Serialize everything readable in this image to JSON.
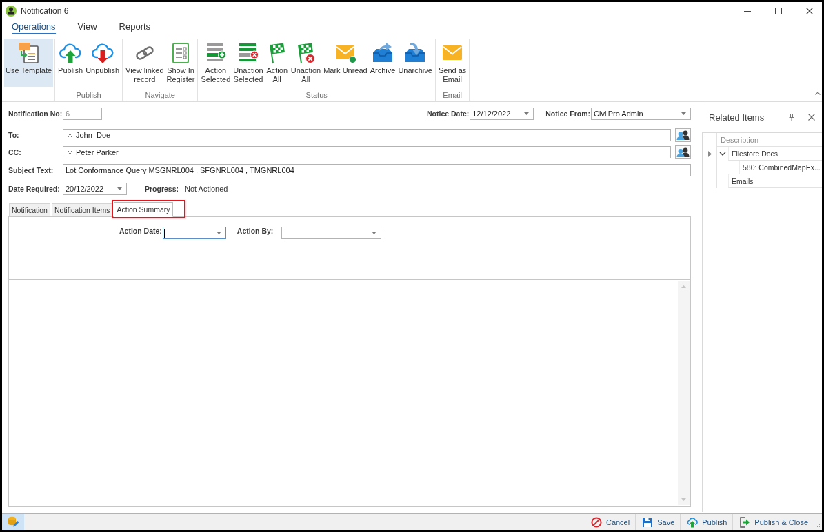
{
  "window": {
    "title": "Notification 6"
  },
  "ribbon": {
    "tabs": [
      {
        "label": "Operations",
        "selected": true
      },
      {
        "label": "View",
        "selected": false
      },
      {
        "label": "Reports",
        "selected": false
      }
    ],
    "groups": [
      {
        "buttons": [
          {
            "kind": "use_template",
            "label": "Use Template",
            "selected": true
          }
        ]
      },
      {
        "label": "Publish",
        "buttons": [
          {
            "kind": "publish",
            "label": "Publish",
            "selected": false
          },
          {
            "kind": "unpublish",
            "label": "Unpublish",
            "selected": false
          }
        ]
      },
      {
        "label": "Navigate",
        "buttons": [
          {
            "kind": "view_linked",
            "label": "View linked\nrecord",
            "selected": false
          },
          {
            "kind": "show_register",
            "label": "Show In\nRegister",
            "selected": false
          }
        ]
      },
      {
        "label": "Status",
        "buttons": [
          {
            "kind": "action_selected",
            "label": "Action\nSelected",
            "selected": false
          },
          {
            "kind": "unaction_selected",
            "label": "Unaction\nSelected",
            "selected": false
          },
          {
            "kind": "action_all",
            "label": "Action\nAll",
            "selected": false
          },
          {
            "kind": "unaction_all",
            "label": "Unaction\nAll",
            "selected": false
          },
          {
            "kind": "mark_unread",
            "label": "Mark Unread",
            "selected": false
          },
          {
            "kind": "archive",
            "label": "Archive",
            "selected": false
          },
          {
            "kind": "unarchive",
            "label": "Unarchive",
            "selected": false
          }
        ]
      },
      {
        "label": "Email",
        "buttons": [
          {
            "kind": "send_email",
            "label": "Send as\nEmail",
            "selected": false
          }
        ]
      }
    ]
  },
  "form": {
    "notification_no": {
      "label": "Notification No:",
      "value": "6",
      "disabled": true
    },
    "notice_date": {
      "label": "Notice Date:",
      "value": "12/12/2022"
    },
    "notice_from": {
      "label": "Notice From:",
      "value": "CivilPro Admin"
    },
    "to": {
      "label": "To:",
      "recipients": [
        "John  Doe"
      ]
    },
    "cc": {
      "label": "CC:",
      "recipients": [
        "Peter Parker"
      ]
    },
    "subject": {
      "label": "Subject Text:",
      "value": "Lot Conformance Query MSGNRL004 , SFGNRL004 , TMGNRL004"
    },
    "date_required": {
      "label": "Date Required:",
      "value": "20/12/2022"
    },
    "progress": {
      "label": "Progress:",
      "value": "Not Actioned"
    }
  },
  "tabs": [
    {
      "label": "Notification",
      "selected": false
    },
    {
      "label": "Notification Items",
      "selected": false
    },
    {
      "label": "Action Summary",
      "selected": true
    }
  ],
  "action_summary": {
    "fields": [
      {
        "label": "Action Date:",
        "focused": true
      },
      {
        "label": "Action By:",
        "focused": false
      }
    ]
  },
  "related_items": {
    "title": "Related Items",
    "columns": [
      "Description"
    ],
    "items": [
      {
        "label": "Filestore Docs",
        "focused": true,
        "expanded": true,
        "children": [
          {
            "label": "580: CombinedMapEx...",
            "focused": false
          }
        ]
      },
      {
        "label": "Emails",
        "focused": false
      }
    ]
  },
  "status_bar": {
    "buttons": [
      {
        "kind": "cancel",
        "label": "Cancel"
      },
      {
        "kind": "save",
        "label": "Save"
      },
      {
        "kind": "publish",
        "label": "Publish"
      },
      {
        "kind": "publish_close",
        "label": "Publish & Close"
      }
    ]
  }
}
